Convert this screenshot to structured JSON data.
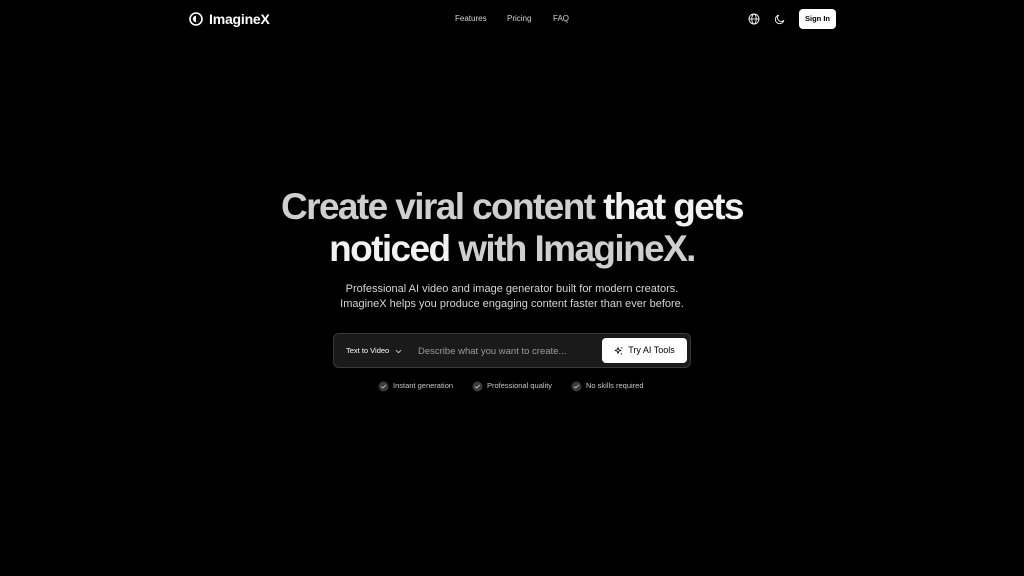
{
  "header": {
    "brand": "ImagineX",
    "nav": {
      "features": "Features",
      "pricing": "Pricing",
      "faq": "FAQ"
    },
    "icons": {
      "language": "globe-icon",
      "theme": "moon-icon"
    },
    "sign_in_label": "Sign In"
  },
  "hero": {
    "line1_part1": "Create viral content",
    "line1_part2": "that gets",
    "line2_part1": "noticed",
    "line2_part2": "with ImagineX.",
    "subtitle_line1": "Professional AI video and image generator built for modern creators.",
    "subtitle_line2": "ImagineX helps you produce engaging content faster than ever before."
  },
  "prompt": {
    "mode_label": "Text to Video",
    "placeholder": "Describe what you want to create...",
    "value": "",
    "submit_label": "Try AI Tools"
  },
  "features": [
    {
      "label": "Instant generation",
      "icon": "check-circle-icon"
    },
    {
      "label": "Professional quality",
      "icon": "check-circle-icon"
    },
    {
      "label": "No skills required",
      "icon": "check-circle-icon"
    }
  ],
  "colors": {
    "background": "#000000",
    "accent": "#ffffff",
    "muted_text": "#cfcfcf",
    "bar_background": "#1a1a1a"
  }
}
